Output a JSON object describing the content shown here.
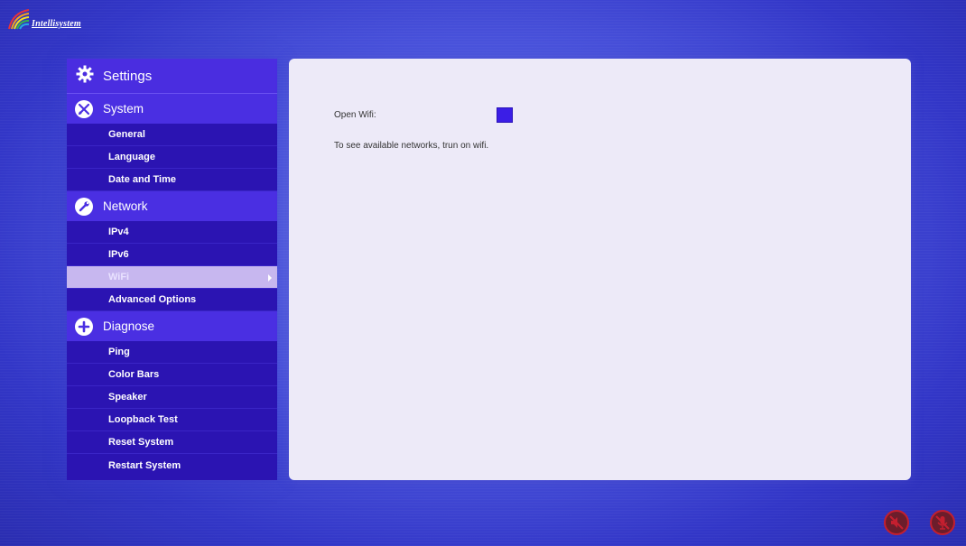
{
  "brand": {
    "logo_text": "Intellisystem"
  },
  "sidebar": {
    "title": "Settings",
    "title_icon": "gear-icon",
    "sections": [
      {
        "label": "System",
        "icon": "tools-icon",
        "items": [
          "General",
          "Language",
          "Date and Time"
        ]
      },
      {
        "label": "Network",
        "icon": "wrench-icon",
        "items": [
          "IPv4",
          "IPv6",
          "WiFi",
          "Advanced Options"
        ]
      },
      {
        "label": "Diagnose",
        "icon": "plus-icon",
        "items": [
          "Ping",
          "Color Bars",
          "Speaker",
          "Loopback Test",
          "Reset System",
          "Restart System"
        ]
      }
    ],
    "selected_item": "WiFi"
  },
  "content": {
    "open_wifi_label": "Open Wifi:",
    "open_wifi_checked": false,
    "hint": "To see available networks, trun on wifi."
  },
  "status_icons": [
    "speaker-muted-icon",
    "microphone-muted-icon"
  ],
  "colors": {
    "sidebar_bg": "#2b14b2",
    "section_bg": "#4a2fe2",
    "selected_item_bg": "#c7b7ef",
    "content_bg": "#edeaf8",
    "toggle": "#3b1ee6",
    "status_icon_ring": "#c41f2f"
  }
}
